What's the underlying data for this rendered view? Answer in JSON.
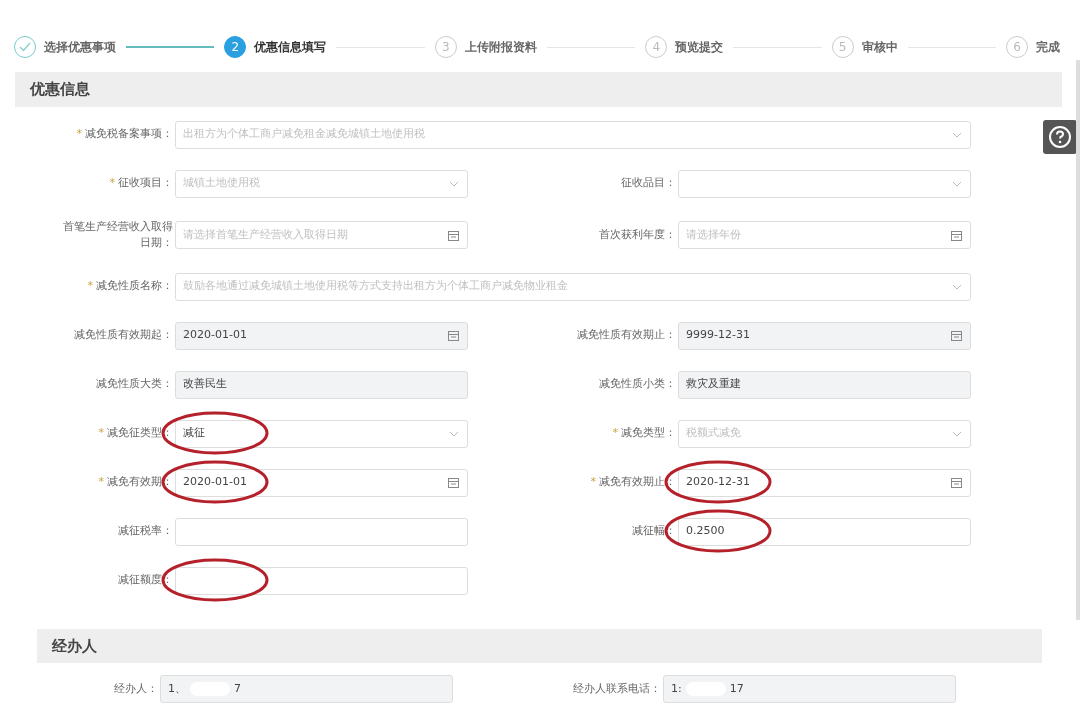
{
  "steps": [
    {
      "label": "选择优惠事项",
      "done": true,
      "selected": false
    },
    {
      "number": "2",
      "label": "优惠信息填写",
      "done": false,
      "selected": true
    },
    {
      "number": "3",
      "label": "上传附报资料",
      "done": false,
      "selected": false
    },
    {
      "number": "4",
      "label": "预览提交",
      "done": false,
      "selected": false
    },
    {
      "number": "5",
      "label": "审核中",
      "done": false,
      "selected": false
    },
    {
      "number": "6",
      "label": "完成",
      "done": false,
      "selected": false
    }
  ],
  "sections": [
    {
      "title": "优惠信息",
      "fields": [
        {
          "marker": "*",
          "label": "减免税备案事项：",
          "kind": "select",
          "placeholder": "出租方为个体工商户减免租金减免城镇土地使用税",
          "disabled": false,
          "wide": true,
          "circled": false
        },
        {
          "marker": "*",
          "label": "征收项目：",
          "kind": "select",
          "placeholder": "城镇土地使用税",
          "disabled": false,
          "circled": false
        },
        {
          "label": "征收品目：",
          "kind": "select",
          "disabled": false,
          "circled": false
        },
        {
          "label": "首笔生产经营收入取得日期：",
          "kind": "date",
          "placeholder": "请选择首笔生产经营收入取得日期",
          "disabled": false,
          "circled": false
        },
        {
          "label": "首次获利年度：",
          "kind": "date",
          "placeholder": "请选择年份",
          "disabled": false,
          "circled": false
        },
        {
          "marker": "*",
          "label": "减免性质名称：",
          "kind": "select",
          "placeholder": "鼓励各地通过减免城镇土地使用税等方式支持出租方为个体工商户减免物业租金",
          "disabled": false,
          "wide": true,
          "circled": false
        },
        {
          "label": "减免性质有效期起：",
          "kind": "date",
          "value": "2020-01-01",
          "disabled": true,
          "circled": false
        },
        {
          "label": "减免性质有效期止：",
          "kind": "date",
          "value": "9999-12-31",
          "disabled": true,
          "circled": false
        },
        {
          "label": "减免性质大类：",
          "kind": "text",
          "value": "改善民生",
          "disabled": true,
          "circled": false
        },
        {
          "label": "减免性质小类：",
          "kind": "text",
          "value": "救灾及重建",
          "disabled": true,
          "circled": false
        },
        {
          "marker": "*",
          "label": "减免征类型：",
          "kind": "select",
          "value": "减征",
          "disabled": false,
          "circled": true
        },
        {
          "marker": "*",
          "label": "减免类型：",
          "kind": "select",
          "placeholder": "税额式减免",
          "disabled": false,
          "circled": false
        },
        {
          "marker": "*",
          "label": "减免有效期：",
          "kind": "date",
          "value": "2020-01-01",
          "disabled": false,
          "circled": true
        },
        {
          "marker": "*",
          "label": "减免有效期止：",
          "kind": "date",
          "value": "2020-12-31",
          "disabled": false,
          "circled": true
        },
        {
          "label": "减征税率：",
          "kind": "text",
          "disabled": false,
          "circled": false
        },
        {
          "label": "减征幅：",
          "kind": "text",
          "value": "0.2500",
          "disabled": false,
          "circled": true
        },
        {
          "label": "减征额度：",
          "kind": "text",
          "disabled": false,
          "circled": true
        }
      ]
    },
    {
      "title": "经办人",
      "fields": [
        {
          "label": "经办人：",
          "kind": "text",
          "value_start": "1、",
          "value_end": "7",
          "redacted": true,
          "disabled": true,
          "circled": false
        },
        {
          "label": "经办人联系电话：",
          "kind": "text",
          "value_start": "1:",
          "value_end": "17",
          "redacted": true,
          "disabled": true,
          "circled": false
        }
      ]
    }
  ]
}
